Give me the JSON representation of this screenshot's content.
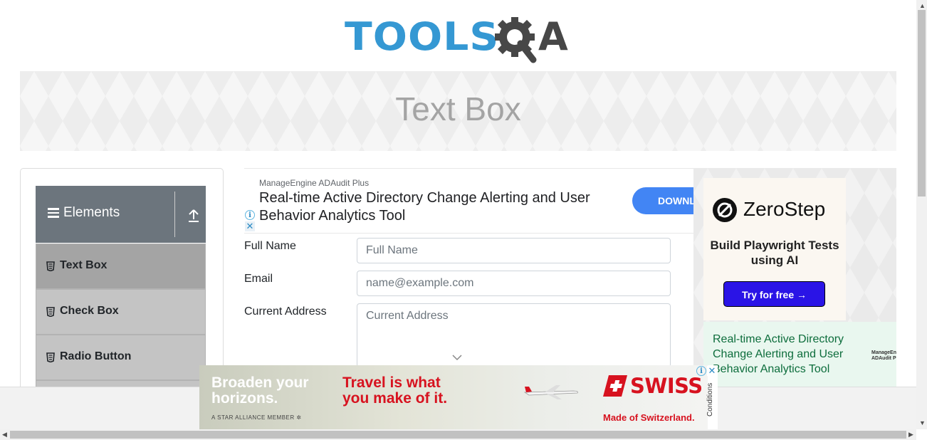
{
  "logo": {
    "part1": "TOOLS",
    "part2": "A"
  },
  "page": {
    "title": "Text Box"
  },
  "sidebar": {
    "group_title": "Elements",
    "items": [
      {
        "label": "Text Box",
        "icon": "html5-icon",
        "active": true
      },
      {
        "label": "Check Box",
        "icon": "html5-icon"
      },
      {
        "label": "Radio Button",
        "icon": "html5-icon"
      }
    ]
  },
  "ad_top": {
    "advertiser": "ManageEngine ADAudit Plus",
    "headline": "Real-time Active Directory Change Alerting and User Behavior Analytics Tool",
    "cta": "DOWNL"
  },
  "form": {
    "full_name": {
      "label": "Full Name",
      "placeholder": "Full Name"
    },
    "email": {
      "label": "Email",
      "placeholder": "name@example.com"
    },
    "address": {
      "label": "Current Address",
      "placeholder": "Current Address"
    }
  },
  "ad_right": {
    "brand": "ZeroStep",
    "tagline": "Build Playwright Tests using AI",
    "cta": "Try for free →",
    "bottom_headline": "Real-time Active Directory Change Alerting and User Behavior Analytics Tool",
    "bottom_brand_line1": "ManageEngine",
    "bottom_brand_line2": "ADAudit Plus"
  },
  "ad_bottom": {
    "left_text": "Broaden your horizons.",
    "member_text": "A STAR ALLIANCE MEMBER",
    "headline": "Travel is what you make of it.",
    "brand": "SWISS",
    "motto": "Made of Switzerland.",
    "conditions": "Conditions"
  },
  "colors": {
    "logo_blue": "#3598d3",
    "logo_dark": "#474747",
    "group_header": "#6c757d",
    "menu_item": "#c4c4c4",
    "menu_item_active": "#a4a4a4",
    "zerostep_cta": "#2a14e6",
    "swiss_red": "#d7121f"
  }
}
